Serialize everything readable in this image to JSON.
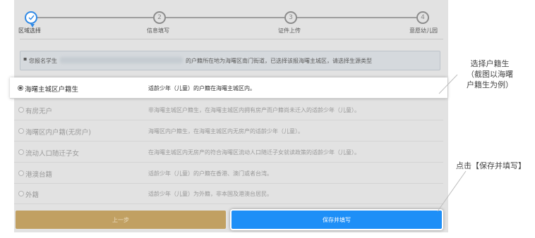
{
  "steps": [
    {
      "label": "区域选择",
      "number": "",
      "active": true
    },
    {
      "label": "信息填写",
      "number": "2",
      "active": false
    },
    {
      "label": "证件上传",
      "number": "3",
      "active": false
    },
    {
      "label": "意愿幼儿园",
      "number": "4",
      "active": false
    }
  ],
  "notice": {
    "prefix": "您报名学生",
    "suffix": "的户籍所在地为海曙区南门街道，已选择该报海曙主城区，请选择生源类型"
  },
  "options": [
    {
      "label": "海曙主城区户籍生",
      "desc": "适龄少年（儿童）的户籍在海曙主城区内。",
      "selected": true
    },
    {
      "label": "有房无户",
      "desc": "非海曙主城区户籍生，在海曙主城区内拥有房产而户籍尚未迁入的适龄少年（儿童）。",
      "selected": false
    },
    {
      "label": "海曙区内户籍(无房户)",
      "desc": "海曙区内户籍生，在海曙主城区内无房产的适龄少年（儿童）。",
      "selected": false
    },
    {
      "label": "流动人口随迁子女",
      "desc": "在海曙主城区内无房产的符合海曙区流动人口随迁子女就读政策的适龄少年（儿童）。",
      "selected": false
    },
    {
      "label": "港澳台籍",
      "desc": "适龄少年（儿童）的户籍在香港、澳门或者台湾。",
      "selected": false
    },
    {
      "label": "外籍",
      "desc": "适龄少年（儿童）为外籍，非本国及港澳台居民。",
      "selected": false
    }
  ],
  "buttons": {
    "prev": "上一步",
    "save": "保存并填写"
  },
  "annotations": {
    "select_line1": "选择户籍生",
    "select_line2": "（截图以海曙",
    "select_line3": "户籍生为例）",
    "save_hint": "点击【保存并填写】"
  },
  "colors": {
    "accent": "#1e8ff7",
    "prev_button": "#c1a062",
    "step_active": "#2f89e6"
  }
}
